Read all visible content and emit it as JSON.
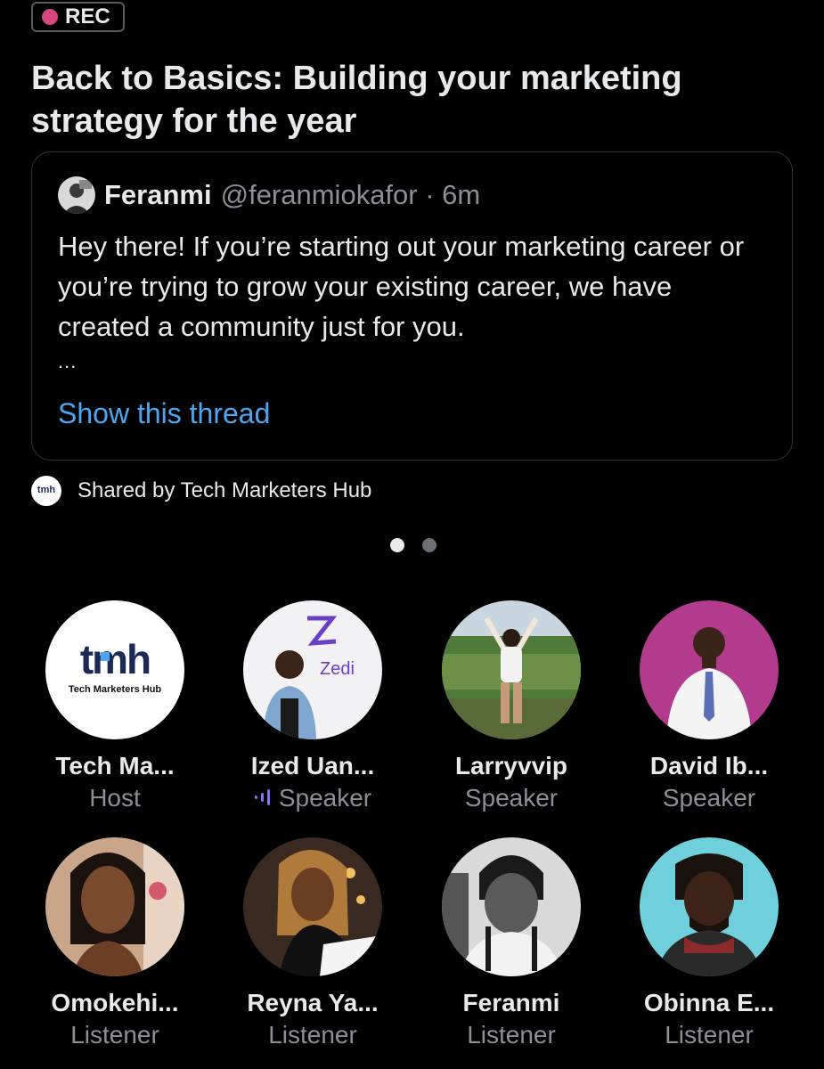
{
  "rec_badge": {
    "label": "REC"
  },
  "space": {
    "title": "Back to Basics: Building your marketing strategy for the year"
  },
  "tweet": {
    "name": "Feranmi",
    "handle": "@feranmiokafor · 6m",
    "text": "Hey there! If you’re starting out your marketing career or you’re trying to grow your existing career, we have created a community just for you.",
    "ellipsis": "...",
    "show_thread_label": "Show this thread"
  },
  "shared": {
    "text": "Shared by Tech Marketers Hub",
    "logo_text": "tmh"
  },
  "pager": {
    "total": 2,
    "active": 1
  },
  "host_logo": {
    "wordmark": "tmh",
    "subtitle": "Tech Marketers Hub"
  },
  "speaker_logo": {
    "text": "Zedi"
  },
  "participants": [
    {
      "name": "Tech Ma...",
      "role": "Host"
    },
    {
      "name": "Ized Uan...",
      "role": "Speaker"
    },
    {
      "name": "Larryvvip",
      "role": "Speaker"
    },
    {
      "name": "David Ib...",
      "role": "Speaker"
    },
    {
      "name": "Omokehi...",
      "role": "Listener"
    },
    {
      "name": "Reyna Ya...",
      "role": "Listener"
    },
    {
      "name": "Feranmi",
      "role": "Listener"
    },
    {
      "name": "Obinna E...",
      "role": "Listener"
    }
  ],
  "colors": {
    "rec_dot": "#d6477f",
    "link": "#4ea6f0",
    "speaking": "#8a6cf0",
    "muted": "#8b9096",
    "bg": "#000000"
  }
}
